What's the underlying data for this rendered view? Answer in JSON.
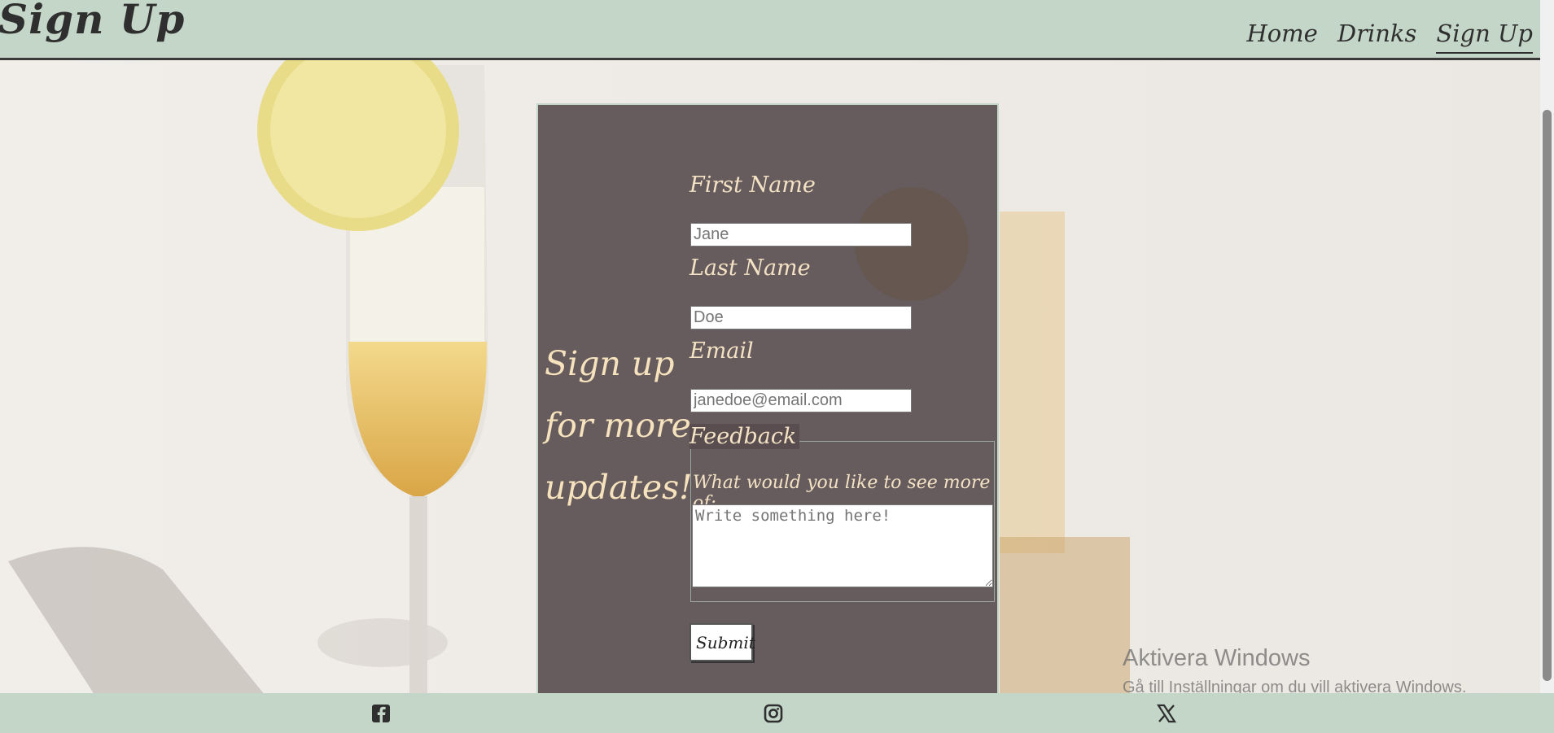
{
  "header": {
    "brand": "Sign Up",
    "nav": [
      {
        "label": "Home"
      },
      {
        "label": "Drinks"
      },
      {
        "label": "Sign Up",
        "active": true
      }
    ]
  },
  "form": {
    "side_heading": "Sign up for more updates!",
    "first_name": {
      "label": "First Name",
      "placeholder": "Jane"
    },
    "last_name": {
      "label": "Last Name",
      "placeholder": "Doe"
    },
    "email": {
      "label": "Email",
      "placeholder": "janedoe@email.com"
    },
    "feedback": {
      "legend": "Feedback",
      "prompt": "What would you like to see more of:",
      "placeholder": "Write something here!"
    },
    "submit_label": "Submit"
  },
  "watermark": {
    "title": "Aktivera Windows",
    "subtitle": "Gå till Inställningar om du vill aktivera Windows."
  },
  "footer": {
    "icons": [
      "facebook-icon",
      "instagram-icon",
      "x-twitter-icon"
    ]
  },
  "colors": {
    "header_bg": "#c4d6c8",
    "panel_bg": "#584c4e",
    "accent_text": "#f6e3be"
  }
}
